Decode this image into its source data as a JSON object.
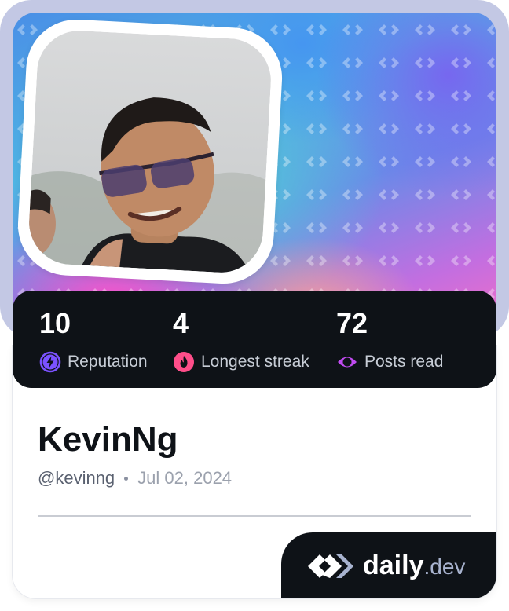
{
  "profile": {
    "name": "KevinNg",
    "handle": "@kevinng",
    "joined": "Jul 02, 2024"
  },
  "stats": [
    {
      "value": "10",
      "label": "Reputation",
      "icon": "lightning-icon",
      "color": "#7b52ff"
    },
    {
      "value": "4",
      "label": "Longest streak",
      "icon": "flame-icon",
      "color": "#ff4e8a"
    },
    {
      "value": "72",
      "label": "Posts read",
      "icon": "eye-icon",
      "color": "#c04bf0"
    }
  ],
  "brand": {
    "name": "daily",
    "suffix": ".dev",
    "icon": "daily-dev-logo-icon"
  },
  "colors": {
    "frame": "#c3c8e4",
    "dark": "#0e1217",
    "label": "#c7cdd6"
  }
}
